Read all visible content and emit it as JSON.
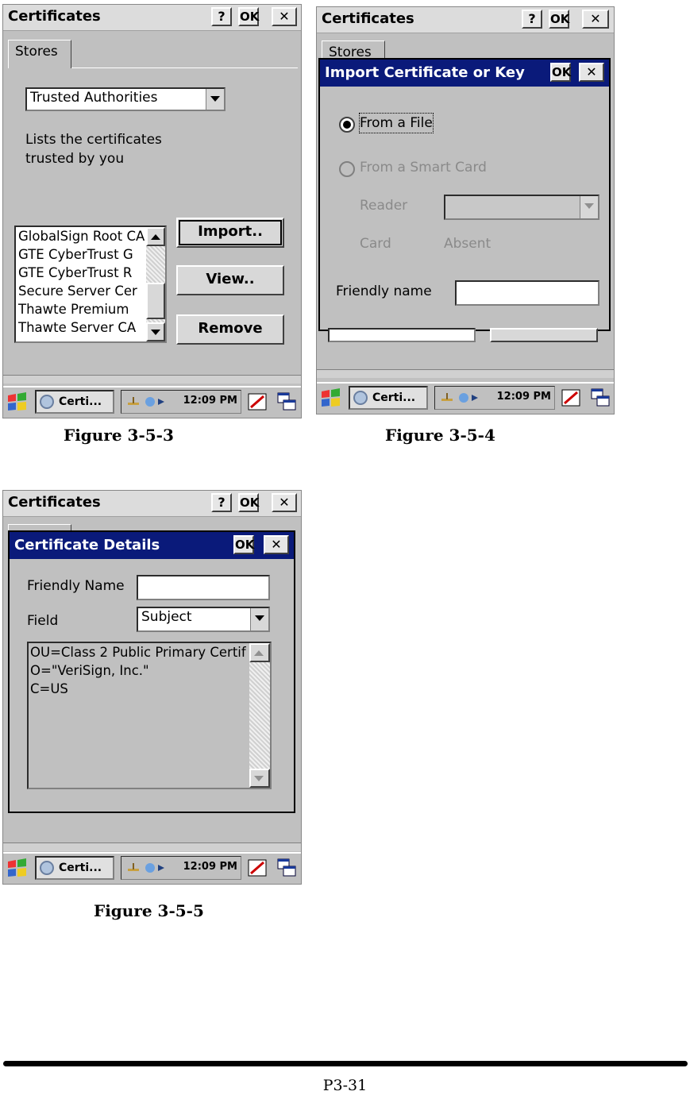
{
  "shots": {
    "fig3": {
      "window_title": "Certificates",
      "help_label": "?",
      "ok_label": "OK",
      "close_label": "✕",
      "tab_label": "Stores",
      "store_select": "Trusted Authorities",
      "description": [
        "Lists the certificates",
        "trusted by you"
      ],
      "cert_list": [
        "GlobalSign Root CA",
        "GTE CyberTrust G",
        "GTE CyberTrust R",
        "Secure Server Cer",
        "Thawte Premium",
        "Thawte Server CA"
      ],
      "buttons": {
        "import": "Import..",
        "view": "View..",
        "remove": "Remove"
      }
    },
    "fig4": {
      "window_title": "Certificates",
      "help_label": "?",
      "ok_label": "OK",
      "close_label": "✕",
      "tab_label": "Stores",
      "dialog_title": "Import Certificate or Key",
      "dialog_ok": "OK",
      "dialog_close": "✕",
      "from_file": "From a File",
      "from_smart_card": "From a Smart Card",
      "reader_label": "Reader",
      "card_label": "Card",
      "card_value": "Absent",
      "friendly_name_label": "Friendly name",
      "friendly_name_value": ""
    },
    "fig5": {
      "window_title": "Certificates",
      "help_label": "?",
      "ok_label": "OK",
      "close_label": "✕",
      "dialog_title": "Certificate Details",
      "dialog_ok": "OK",
      "dialog_close": "✕",
      "friendly_name_label": "Friendly Name",
      "friendly_name_value": "",
      "field_label": "Field",
      "field_value": "Subject",
      "details_lines": [
        "OU=Class 2 Public Primary Certif",
        "O=\"VeriSign, Inc.\"",
        "C=US"
      ]
    }
  },
  "taskbar": {
    "app_label": "Certi...",
    "clock": "12:09 PM"
  },
  "captions": {
    "fig3": "Figure 3-5-3",
    "fig4": "Figure 3-5-4",
    "fig5": "Figure 3-5-5"
  },
  "page_number": "P3-31",
  "colors": {
    "dialog_title_bg": "#0a1a7a",
    "window_bg": "#c0c0c0"
  }
}
